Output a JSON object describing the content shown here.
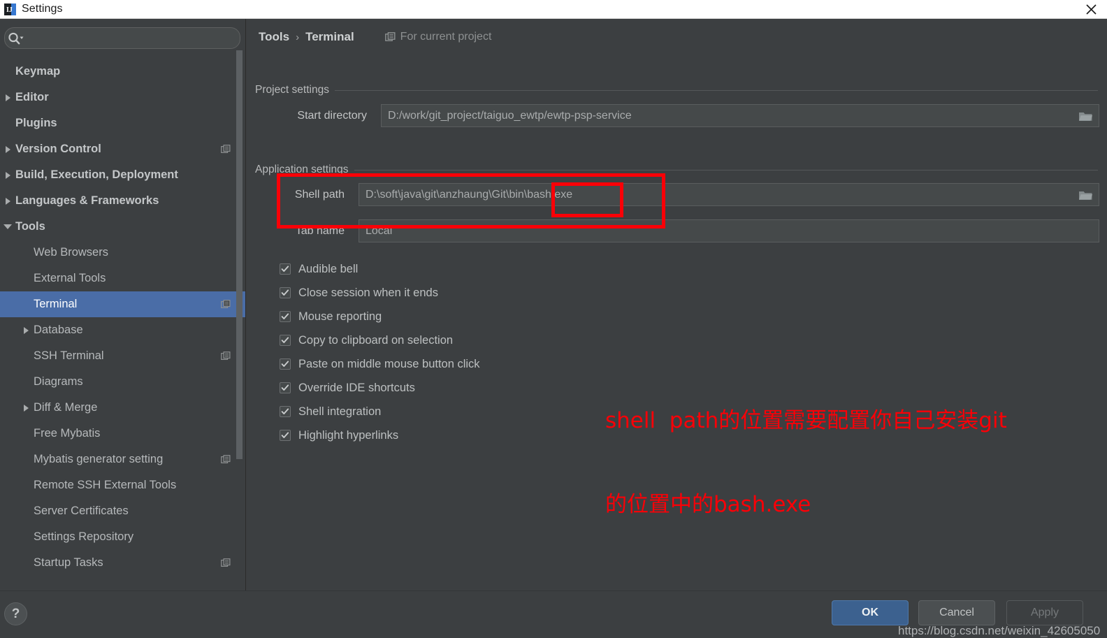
{
  "window": {
    "title": "Settings",
    "logo_letter": "IJ",
    "close_icon": "close-icon"
  },
  "sidebar": {
    "search": {
      "placeholder": "",
      "value": "",
      "icon": "search-icon"
    },
    "items": [
      {
        "label": "Keymap",
        "level": 0,
        "bold": true,
        "arrow": "none",
        "badge": false,
        "selected": false
      },
      {
        "label": "Editor",
        "level": 0,
        "bold": true,
        "arrow": "right",
        "badge": false,
        "selected": false
      },
      {
        "label": "Plugins",
        "level": 0,
        "bold": true,
        "arrow": "none",
        "badge": false,
        "selected": false
      },
      {
        "label": "Version Control",
        "level": 0,
        "bold": true,
        "arrow": "right",
        "badge": true,
        "selected": false
      },
      {
        "label": "Build, Execution, Deployment",
        "level": 0,
        "bold": true,
        "arrow": "right",
        "badge": false,
        "selected": false
      },
      {
        "label": "Languages & Frameworks",
        "level": 0,
        "bold": true,
        "arrow": "right",
        "badge": false,
        "selected": false
      },
      {
        "label": "Tools",
        "level": 0,
        "bold": true,
        "arrow": "down",
        "badge": false,
        "selected": false
      },
      {
        "label": "Web Browsers",
        "level": 1,
        "bold": false,
        "arrow": "none",
        "badge": false,
        "selected": false
      },
      {
        "label": "External Tools",
        "level": 1,
        "bold": false,
        "arrow": "none",
        "badge": false,
        "selected": false
      },
      {
        "label": "Terminal",
        "level": 1,
        "bold": false,
        "arrow": "none",
        "badge": true,
        "selected": true
      },
      {
        "label": "Database",
        "level": 1,
        "bold": false,
        "arrow": "right",
        "badge": false,
        "selected": false
      },
      {
        "label": "SSH Terminal",
        "level": 1,
        "bold": false,
        "arrow": "none",
        "badge": true,
        "selected": false
      },
      {
        "label": "Diagrams",
        "level": 1,
        "bold": false,
        "arrow": "none",
        "badge": false,
        "selected": false
      },
      {
        "label": "Diff & Merge",
        "level": 1,
        "bold": false,
        "arrow": "right",
        "badge": false,
        "selected": false
      },
      {
        "label": "Free Mybatis",
        "level": 1,
        "bold": false,
        "arrow": "none",
        "badge": false,
        "selected": false
      },
      {
        "label": "Mybatis generator setting",
        "level": 1,
        "bold": false,
        "arrow": "none",
        "badge": true,
        "selected": false
      },
      {
        "label": "Remote SSH External Tools",
        "level": 1,
        "bold": false,
        "arrow": "none",
        "badge": false,
        "selected": false
      },
      {
        "label": "Server Certificates",
        "level": 1,
        "bold": false,
        "arrow": "none",
        "badge": false,
        "selected": false
      },
      {
        "label": "Settings Repository",
        "level": 1,
        "bold": false,
        "arrow": "none",
        "badge": false,
        "selected": false
      },
      {
        "label": "Startup Tasks",
        "level": 1,
        "bold": false,
        "arrow": "none",
        "badge": true,
        "selected": false
      }
    ]
  },
  "main": {
    "breadcrumb": {
      "parent": "Tools",
      "separator": "›",
      "current": "Terminal"
    },
    "scope_note": {
      "icon": "project-scope-icon",
      "label": "For current project"
    },
    "project_section": {
      "title": "Project settings"
    },
    "start_directory": {
      "label": "Start directory",
      "value": "D:/work/git_project/taiguo_ewtp/ewtp-psp-service",
      "browse_icon": "folder-icon"
    },
    "application_section": {
      "title": "Application settings"
    },
    "shell_path": {
      "label": "Shell path",
      "value": "D:\\soft\\java\\git\\anzhaung\\Git\\bin\\bash.exe",
      "browse_icon": "folder-icon"
    },
    "tab_name": {
      "label": "Tab name",
      "value": "Local"
    },
    "checkboxes": [
      {
        "label": "Audible bell",
        "checked": true
      },
      {
        "label": "Close session when it ends",
        "checked": true
      },
      {
        "label": "Mouse reporting",
        "checked": true
      },
      {
        "label": "Copy to clipboard on selection",
        "checked": true
      },
      {
        "label": "Paste on middle mouse button click",
        "checked": true
      },
      {
        "label": "Override IDE shortcuts",
        "checked": true
      },
      {
        "label": "Shell integration",
        "checked": true
      },
      {
        "label": "Highlight hyperlinks",
        "checked": true
      }
    ]
  },
  "annotation": {
    "line1": "shell  path的位置需要配置你自己安装git",
    "line2": "的位置中的bash.exe",
    "color": "#fb0007"
  },
  "footer": {
    "help_label": "?",
    "ok_label": "OK",
    "cancel_label": "Cancel",
    "apply_label": "Apply"
  },
  "watermark": {
    "text": "https://blog.csdn.net/weixin_42605050"
  },
  "colors": {
    "panel_bg": "#3c3f41",
    "field_bg": "#45494a",
    "selection_blue": "#4a6da7",
    "primary_button": "#3c618f",
    "annotation_red": "#fb0007"
  }
}
